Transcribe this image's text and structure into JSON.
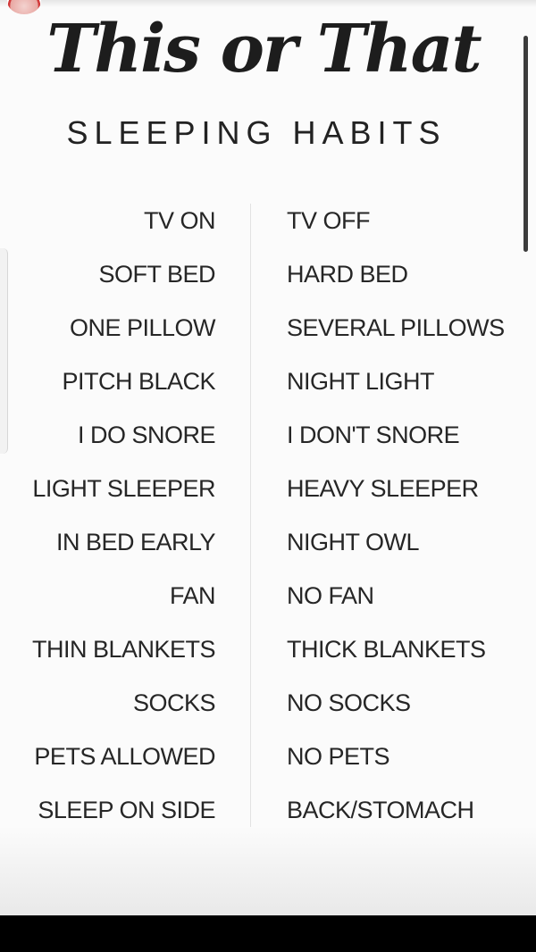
{
  "title": "This or That",
  "subtitle": "SLEEPING HABITS",
  "pairs": [
    {
      "this": "TV ON",
      "that": "TV OFF"
    },
    {
      "this": "SOFT BED",
      "that": "HARD BED"
    },
    {
      "this": "ONE PILLOW",
      "that": "SEVERAL PILLOWS"
    },
    {
      "this": "PITCH BLACK",
      "that": "NIGHT LIGHT"
    },
    {
      "this": "I DO SNORE",
      "that": "I DON'T SNORE"
    },
    {
      "this": "LIGHT SLEEPER",
      "that": "HEAVY SLEEPER"
    },
    {
      "this": "IN BED EARLY",
      "that": "NIGHT OWL"
    },
    {
      "this": "FAN",
      "that": "NO FAN"
    },
    {
      "this": "THIN BLANKETS",
      "that": "THICK BLANKETS"
    },
    {
      "this": "SOCKS",
      "that": "NO SOCKS"
    },
    {
      "this": "PETS ALLOWED",
      "that": "NO PETS"
    },
    {
      "this": "SLEEP ON SIDE",
      "that": "BACK/STOMACH"
    }
  ]
}
